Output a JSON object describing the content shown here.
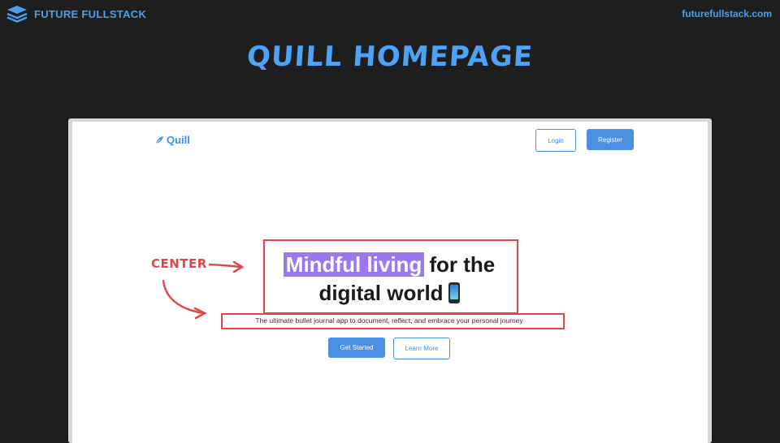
{
  "header": {
    "brand_name": "FUTURE FULLSTACK",
    "site_url": "futurefullstack.com",
    "slide_title": "QUILL HOMEPAGE"
  },
  "app": {
    "logo_text": "Quill",
    "nav": {
      "login_label": "Login",
      "register_label": "Register"
    },
    "hero": {
      "highlight": "Mindful living",
      "line1_rest": "for the",
      "line2": "digital world",
      "subtitle": "The ultimate bullet journal app to document, reflect, and embrace your personal journey",
      "primary_button": "Get Started",
      "secondary_button": "Learn More"
    }
  },
  "annotation": {
    "label": "CENTER"
  },
  "colors": {
    "brand_blue": "#4a9ff0",
    "accent_purple": "#9b77f0",
    "annotation_red": "#e04848",
    "button_blue": "#4a90e2"
  },
  "icons": [
    "layers-icon",
    "feather-icon",
    "phone-emoji-icon"
  ]
}
